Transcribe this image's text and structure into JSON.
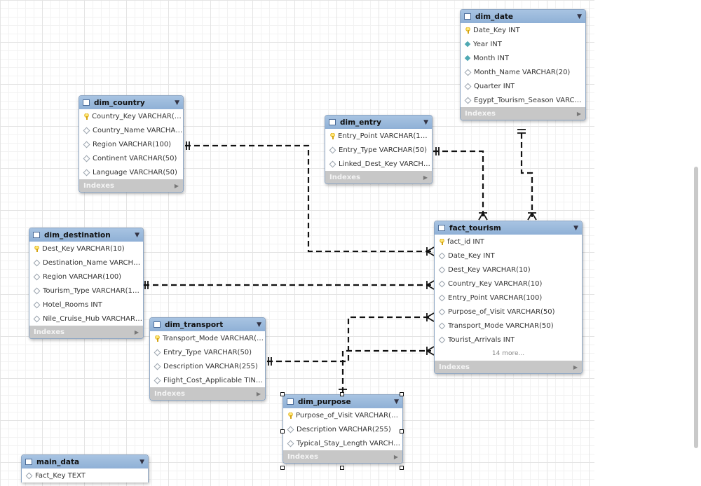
{
  "colors": {
    "header": "#9bbadd",
    "indexes_bar": "#c7c7c7",
    "line": "#111111"
  },
  "tables": {
    "dim_date": {
      "name": "dim_date",
      "indexes": "Indexes",
      "columns": [
        {
          "text": "Date_Key INT",
          "icon": "key"
        },
        {
          "text": "Year INT",
          "icon": "filled"
        },
        {
          "text": "Month INT",
          "icon": "filled"
        },
        {
          "text": "Month_Name VARCHAR(20)",
          "icon": "hollow"
        },
        {
          "text": "Quarter INT",
          "icon": "hollow"
        },
        {
          "text": "Egypt_Tourism_Season VARCHAR(5...",
          "icon": "hollow"
        }
      ]
    },
    "dim_country": {
      "name": "dim_country",
      "indexes": "Indexes",
      "columns": [
        {
          "text": "Country_Key VARCHAR(10)",
          "icon": "key"
        },
        {
          "text": "Country_Name VARCHAR(10...",
          "icon": "hollow"
        },
        {
          "text": "Region VARCHAR(100)",
          "icon": "hollow"
        },
        {
          "text": "Continent VARCHAR(50)",
          "icon": "hollow"
        },
        {
          "text": "Language VARCHAR(50)",
          "icon": "hollow"
        }
      ]
    },
    "dim_entry": {
      "name": "dim_entry",
      "indexes": "Indexes",
      "columns": [
        {
          "text": "Entry_Point VARCHAR(100)",
          "icon": "key"
        },
        {
          "text": "Entry_Type VARCHAR(50)",
          "icon": "hollow"
        },
        {
          "text": "Linked_Dest_Key VARCHAR(10)",
          "icon": "hollow"
        }
      ]
    },
    "dim_destination": {
      "name": "dim_destination",
      "indexes": "Indexes",
      "columns": [
        {
          "text": "Dest_Key VARCHAR(10)",
          "icon": "key"
        },
        {
          "text": "Destination_Name VARCHAR(100)",
          "icon": "hollow"
        },
        {
          "text": "Region VARCHAR(100)",
          "icon": "hollow"
        },
        {
          "text": "Tourism_Type VARCHAR(100)",
          "icon": "hollow"
        },
        {
          "text": "Hotel_Rooms INT",
          "icon": "hollow"
        },
        {
          "text": "Nile_Cruise_Hub VARCHAR(10)",
          "icon": "hollow"
        }
      ]
    },
    "fact_tourism": {
      "name": "fact_tourism",
      "indexes": "Indexes",
      "more": "14 more...",
      "columns": [
        {
          "text": "fact_id INT",
          "icon": "key"
        },
        {
          "text": "Date_Key INT",
          "icon": "hollow"
        },
        {
          "text": "Dest_Key VARCHAR(10)",
          "icon": "hollow"
        },
        {
          "text": "Country_Key VARCHAR(10)",
          "icon": "hollow"
        },
        {
          "text": "Entry_Point VARCHAR(100)",
          "icon": "hollow"
        },
        {
          "text": "Purpose_of_Visit VARCHAR(50)",
          "icon": "hollow"
        },
        {
          "text": "Transport_Mode VARCHAR(50)",
          "icon": "hollow"
        },
        {
          "text": "Tourist_Arrivals INT",
          "icon": "hollow"
        }
      ]
    },
    "dim_transport": {
      "name": "dim_transport",
      "indexes": "Indexes",
      "columns": [
        {
          "text": "Transport_Mode VARCHAR(50)",
          "icon": "key"
        },
        {
          "text": "Entry_Type VARCHAR(50)",
          "icon": "hollow"
        },
        {
          "text": "Description VARCHAR(255)",
          "icon": "hollow"
        },
        {
          "text": "Flight_Cost_Applicable TINYINT(...",
          "icon": "hollow"
        }
      ]
    },
    "dim_purpose": {
      "name": "dim_purpose",
      "indexes": "Indexes",
      "columns": [
        {
          "text": "Purpose_of_Visit VARCHAR(50)",
          "icon": "key"
        },
        {
          "text": "Description VARCHAR(255)",
          "icon": "hollow"
        },
        {
          "text": "Typical_Stay_Length VARCHAR(2...",
          "icon": "hollow"
        }
      ]
    },
    "main_data": {
      "name": "main_data",
      "columns": [
        {
          "text": "Fact_Key TEXT",
          "icon": "hollow"
        }
      ]
    }
  }
}
